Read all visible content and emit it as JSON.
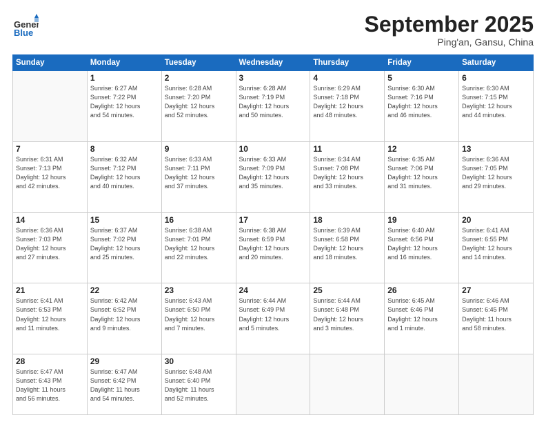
{
  "logo": {
    "line1": "General",
    "line2": "Blue"
  },
  "title": "September 2025",
  "location": "Ping'an, Gansu, China",
  "weekdays": [
    "Sunday",
    "Monday",
    "Tuesday",
    "Wednesday",
    "Thursday",
    "Friday",
    "Saturday"
  ],
  "weeks": [
    [
      {
        "day": "",
        "info": ""
      },
      {
        "day": "1",
        "info": "Sunrise: 6:27 AM\nSunset: 7:22 PM\nDaylight: 12 hours\nand 54 minutes."
      },
      {
        "day": "2",
        "info": "Sunrise: 6:28 AM\nSunset: 7:20 PM\nDaylight: 12 hours\nand 52 minutes."
      },
      {
        "day": "3",
        "info": "Sunrise: 6:28 AM\nSunset: 7:19 PM\nDaylight: 12 hours\nand 50 minutes."
      },
      {
        "day": "4",
        "info": "Sunrise: 6:29 AM\nSunset: 7:18 PM\nDaylight: 12 hours\nand 48 minutes."
      },
      {
        "day": "5",
        "info": "Sunrise: 6:30 AM\nSunset: 7:16 PM\nDaylight: 12 hours\nand 46 minutes."
      },
      {
        "day": "6",
        "info": "Sunrise: 6:30 AM\nSunset: 7:15 PM\nDaylight: 12 hours\nand 44 minutes."
      }
    ],
    [
      {
        "day": "7",
        "info": "Sunrise: 6:31 AM\nSunset: 7:13 PM\nDaylight: 12 hours\nand 42 minutes."
      },
      {
        "day": "8",
        "info": "Sunrise: 6:32 AM\nSunset: 7:12 PM\nDaylight: 12 hours\nand 40 minutes."
      },
      {
        "day": "9",
        "info": "Sunrise: 6:33 AM\nSunset: 7:11 PM\nDaylight: 12 hours\nand 37 minutes."
      },
      {
        "day": "10",
        "info": "Sunrise: 6:33 AM\nSunset: 7:09 PM\nDaylight: 12 hours\nand 35 minutes."
      },
      {
        "day": "11",
        "info": "Sunrise: 6:34 AM\nSunset: 7:08 PM\nDaylight: 12 hours\nand 33 minutes."
      },
      {
        "day": "12",
        "info": "Sunrise: 6:35 AM\nSunset: 7:06 PM\nDaylight: 12 hours\nand 31 minutes."
      },
      {
        "day": "13",
        "info": "Sunrise: 6:36 AM\nSunset: 7:05 PM\nDaylight: 12 hours\nand 29 minutes."
      }
    ],
    [
      {
        "day": "14",
        "info": "Sunrise: 6:36 AM\nSunset: 7:03 PM\nDaylight: 12 hours\nand 27 minutes."
      },
      {
        "day": "15",
        "info": "Sunrise: 6:37 AM\nSunset: 7:02 PM\nDaylight: 12 hours\nand 25 minutes."
      },
      {
        "day": "16",
        "info": "Sunrise: 6:38 AM\nSunset: 7:01 PM\nDaylight: 12 hours\nand 22 minutes."
      },
      {
        "day": "17",
        "info": "Sunrise: 6:38 AM\nSunset: 6:59 PM\nDaylight: 12 hours\nand 20 minutes."
      },
      {
        "day": "18",
        "info": "Sunrise: 6:39 AM\nSunset: 6:58 PM\nDaylight: 12 hours\nand 18 minutes."
      },
      {
        "day": "19",
        "info": "Sunrise: 6:40 AM\nSunset: 6:56 PM\nDaylight: 12 hours\nand 16 minutes."
      },
      {
        "day": "20",
        "info": "Sunrise: 6:41 AM\nSunset: 6:55 PM\nDaylight: 12 hours\nand 14 minutes."
      }
    ],
    [
      {
        "day": "21",
        "info": "Sunrise: 6:41 AM\nSunset: 6:53 PM\nDaylight: 12 hours\nand 11 minutes."
      },
      {
        "day": "22",
        "info": "Sunrise: 6:42 AM\nSunset: 6:52 PM\nDaylight: 12 hours\nand 9 minutes."
      },
      {
        "day": "23",
        "info": "Sunrise: 6:43 AM\nSunset: 6:50 PM\nDaylight: 12 hours\nand 7 minutes."
      },
      {
        "day": "24",
        "info": "Sunrise: 6:44 AM\nSunset: 6:49 PM\nDaylight: 12 hours\nand 5 minutes."
      },
      {
        "day": "25",
        "info": "Sunrise: 6:44 AM\nSunset: 6:48 PM\nDaylight: 12 hours\nand 3 minutes."
      },
      {
        "day": "26",
        "info": "Sunrise: 6:45 AM\nSunset: 6:46 PM\nDaylight: 12 hours\nand 1 minute."
      },
      {
        "day": "27",
        "info": "Sunrise: 6:46 AM\nSunset: 6:45 PM\nDaylight: 11 hours\nand 58 minutes."
      }
    ],
    [
      {
        "day": "28",
        "info": "Sunrise: 6:47 AM\nSunset: 6:43 PM\nDaylight: 11 hours\nand 56 minutes."
      },
      {
        "day": "29",
        "info": "Sunrise: 6:47 AM\nSunset: 6:42 PM\nDaylight: 11 hours\nand 54 minutes."
      },
      {
        "day": "30",
        "info": "Sunrise: 6:48 AM\nSunset: 6:40 PM\nDaylight: 11 hours\nand 52 minutes."
      },
      {
        "day": "",
        "info": ""
      },
      {
        "day": "",
        "info": ""
      },
      {
        "day": "",
        "info": ""
      },
      {
        "day": "",
        "info": ""
      }
    ]
  ]
}
